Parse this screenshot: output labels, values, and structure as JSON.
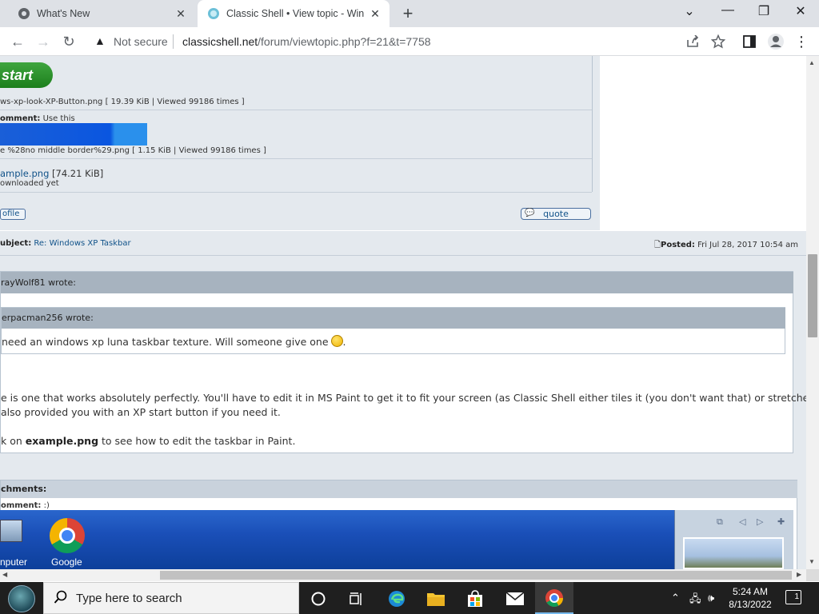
{
  "browser": {
    "tabs": [
      {
        "title": "What's New",
        "close": "✕"
      },
      {
        "title": "Classic Shell • View topic - Windows XP Taskbar",
        "close": "✕"
      }
    ],
    "new_tab": "+",
    "window_controls": {
      "collapse": "⌄",
      "minimize": "—",
      "restore": "❐",
      "close": "✕"
    },
    "nav": {
      "back": "←",
      "forward": "→",
      "reload": "↻"
    },
    "omnibox": {
      "security": "Not secure",
      "url_host": "classicshell.net",
      "url_path": "/forum/viewtopic.php?f=21&t=7758"
    }
  },
  "post1": {
    "start_button_text": "start",
    "attachment1": {
      "name": "ws-xp-look-XP-Button.png",
      "meta": " [ 19.39 KiB | Viewed 99186 times ]"
    },
    "attachment2": {
      "comment_label": "omment:",
      "comment": " Use this",
      "name": "e %28no middle border%29.png",
      "meta": " [ 1.15 KiB | Viewed 99186 times ]"
    },
    "attachment3": {
      "name": "ample.png",
      "size": " [74.21 KiB]",
      "note": "ownloaded yet"
    },
    "profile_label": "ofile",
    "quote_label": "quote"
  },
  "post2": {
    "subject_label": "ubject:",
    "subject_link": "Re: Windows XP Taskbar",
    "posted_label": "Posted:",
    "posted_date": "Fri Jul 28, 2017 10:54 am",
    "outer_quote_head": "rayWolf81 wrote:",
    "inner_quote_head": "erpacman256 wrote:",
    "inner_quote_text": "need an windows xp luna taskbar texture. Will someone give one",
    "inner_quote_end": ".",
    "body_line1": "e is one that works absolutely perfectly. You'll have to edit it in MS Paint to get it to fit your screen (as Classic Shell either tiles it (you don't want that) or stretches it).",
    "body_line2": "also provided you with an XP start button if you need it.",
    "body_line3_pre": "k on ",
    "body_line3_bold": "example.png",
    "body_line3_post": " to see how to edit the taskbar in Paint.",
    "attachments_head": "chments:",
    "attachment_comment_label": "omment:",
    "attachment_comment": " :)",
    "desktop_icons": [
      "nputer",
      "Google"
    ]
  },
  "taskbar": {
    "search_placeholder": "Type here to search",
    "time": "5:24 AM",
    "date": "8/13/2022",
    "notifications_count": "1"
  }
}
